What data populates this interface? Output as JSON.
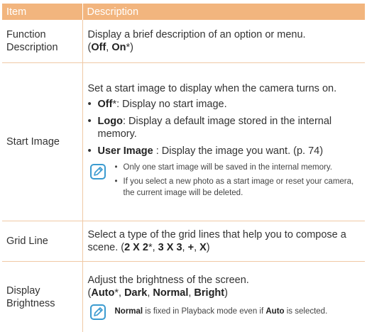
{
  "page_number": "",
  "header": {
    "item": "Item",
    "description": "Description"
  },
  "rows": [
    {
      "item": "Function Description",
      "text": "Display a brief description of an option or menu.",
      "opts": {
        "open": "(",
        "a": "Off",
        "sep": ", ",
        "b": "On",
        "star": "*",
        "close": ")"
      }
    },
    {
      "item": "Start Image",
      "intro": "Set a start image to display when the camera turns on.",
      "bullets": [
        {
          "term": "Off",
          "star": "*",
          "text": ": Display no start image."
        },
        {
          "term": "Logo",
          "star": "",
          "text": ": Display a default image stored in the internal memory."
        },
        {
          "term": "User Image",
          "star": "",
          "text": " : Display the image you want. (p. 74)"
        }
      ],
      "note_icon": "note-pencil-icon",
      "notes": [
        "Only one start image will be saved in the internal memory.",
        "If you select a new photo as a start image or reset your camera, the current image will be deleted."
      ]
    },
    {
      "item": "Grid Line",
      "text": "Select a type of the grid lines that help you to compose a scene. (",
      "opts": [
        "2 X 2",
        "*",
        ", ",
        "3 X 3",
        ", ",
        "+",
        ", ",
        "X",
        ")"
      ]
    },
    {
      "item": "Display Brightness",
      "text": "Adjust the brightness of the screen.",
      "opts": [
        "(",
        "Auto",
        "*",
        ", ",
        "Dark",
        ", ",
        "Normal",
        ", ",
        "Bright",
        ")"
      ],
      "note_icon": "note-pencil-icon",
      "note": {
        "a": "Normal",
        "b": " is fixed in Playback mode even if ",
        "c": "Auto",
        "d": " is selected."
      }
    }
  ],
  "colors": {
    "header_bg": "#f2b57e",
    "rule": "#f0c9a5",
    "text": "#333333"
  }
}
